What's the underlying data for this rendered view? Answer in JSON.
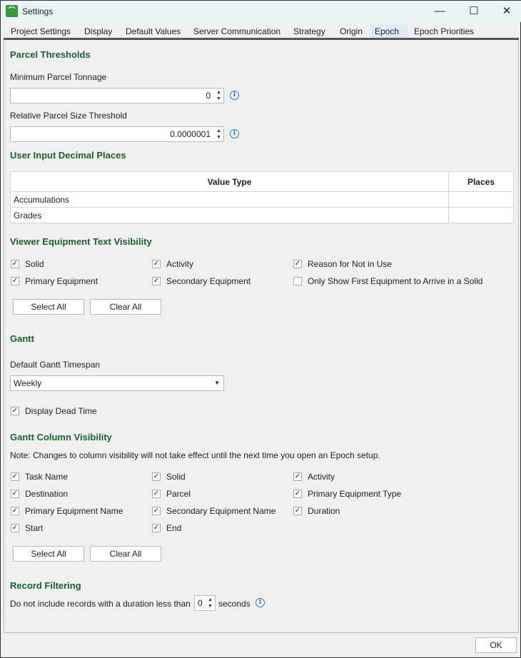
{
  "window": {
    "title": "Settings",
    "minimize": "—",
    "maximize": "☐",
    "close": "✕"
  },
  "tabs": [
    "Project Settings",
    "Display",
    "Default Values",
    "Server Communication",
    "Strategy",
    "Origin",
    "Epoch",
    "Epoch Priorities"
  ],
  "active_tab": "Epoch",
  "parcel": {
    "heading": "Parcel Thresholds",
    "min_label": "Minimum Parcel Tonnage",
    "min_value": "0",
    "rel_label": "Relative Parcel Size Threshold",
    "rel_value": "0.0000001"
  },
  "decimals": {
    "heading": "User Input Decimal Places",
    "col_value_type": "Value Type",
    "col_places": "Places",
    "rows": [
      {
        "type": "Accumulations",
        "places": ""
      },
      {
        "type": "Grades",
        "places": ""
      }
    ]
  },
  "viewer": {
    "heading": "Viewer Equipment Text Visibility",
    "items": [
      {
        "label": "Solid",
        "checked": true
      },
      {
        "label": "Activity",
        "checked": true
      },
      {
        "label": "Reason for Not in Use",
        "checked": true
      },
      {
        "label": "Primary Equipment",
        "checked": true
      },
      {
        "label": "Secondary Equipment",
        "checked": true
      },
      {
        "label": "Only Show First Equipment to Arrive in a Solid",
        "checked": false
      }
    ],
    "select_all": "Select All",
    "clear_all": "Clear All"
  },
  "gantt": {
    "heading": "Gantt",
    "timespan_label": "Default Gantt Timespan",
    "timespan_value": "Weekly",
    "dead_time_label": "Display Dead Time",
    "dead_time_checked": true
  },
  "columns": {
    "heading": "Gantt Column Visibility",
    "note": "Note: Changes to column visibility will not take effect until the next time you open an Epoch setup.",
    "items": [
      {
        "label": "Task Name",
        "checked": true
      },
      {
        "label": "Solid",
        "checked": true
      },
      {
        "label": "Activity",
        "checked": true
      },
      {
        "label": "Destination",
        "checked": true
      },
      {
        "label": "Parcel",
        "checked": true
      },
      {
        "label": "Primary Equipment Type",
        "checked": true
      },
      {
        "label": "Primary Equipment Name",
        "checked": true
      },
      {
        "label": "Secondary Equipment Name",
        "checked": true
      },
      {
        "label": "Duration",
        "checked": true
      },
      {
        "label": "Start",
        "checked": true
      },
      {
        "label": "End",
        "checked": true
      }
    ],
    "select_all": "Select All",
    "clear_all": "Clear All"
  },
  "filter": {
    "heading": "Record Filtering",
    "prefix": "Do not include records with a duration less than",
    "value": "0",
    "suffix": "seconds"
  },
  "footer": {
    "ok": "OK"
  }
}
